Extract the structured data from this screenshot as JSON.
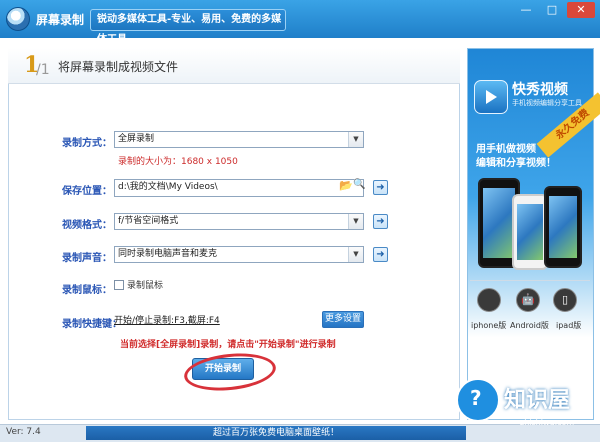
{
  "window": {
    "title": "屏幕录制",
    "slogan": "锐动多媒体工具-专业、易用、免费的多媒体工具",
    "min_icon": "—",
    "max_icon": "□",
    "close_icon": "✕"
  },
  "step": {
    "number": "1",
    "slash": "/1",
    "title": "将屏幕录制成视频文件"
  },
  "form": {
    "mode_label": "录制方式：",
    "mode_value": "全屏录制",
    "size_label": "录制的大小为：1680 x 1050",
    "save_label": "保存位置：",
    "save_value": "d:\\我的文档\\My Videos\\",
    "format_label": "视频格式：",
    "format_value": "f/节省空间格式",
    "audio_label": "录制声音：",
    "audio_value": "同时录制电脑声音和麦克",
    "mouse_label": "录制鼠标：",
    "mouse_checkbox_label": "录制鼠标",
    "hotkey_label": "录制快捷键：",
    "hotkey_value": "开始/停止录制:F3,截屏:F4",
    "more_button": "更多设置",
    "notice": "当前选择[全屏录制]录制，请点击\"开始录制\"进行录制",
    "start_button": "开始录制",
    "go_icon": "➜",
    "dropdown_icon": "▼",
    "folder_icon": "📂",
    "search_icon": "🔍"
  },
  "ad": {
    "brand": "快秀视频",
    "sub": "手机视频编辑分享工具",
    "ribbon": "永久免费",
    "line1": "用手机做视频",
    "line2": "编辑和分享视频！",
    "platforms": [
      {
        "label": "iphone版",
        "icon": ""
      },
      {
        "label": "Android版",
        "icon": "🤖"
      },
      {
        "label": "ipad版",
        "icon": "▯"
      }
    ]
  },
  "watermark": {
    "mark": "?",
    "text": "知识屋",
    "url": "zhishiwu.com"
  },
  "status": {
    "version": "Ver: 7.4",
    "ticker": "超过百万张免费电脑桌面壁纸！"
  },
  "colors": {
    "title_bar": "#1f7fc9",
    "label_blue": "#2a56b5",
    "notice_red": "#d02a2a",
    "annotation_red": "#d8323a"
  }
}
